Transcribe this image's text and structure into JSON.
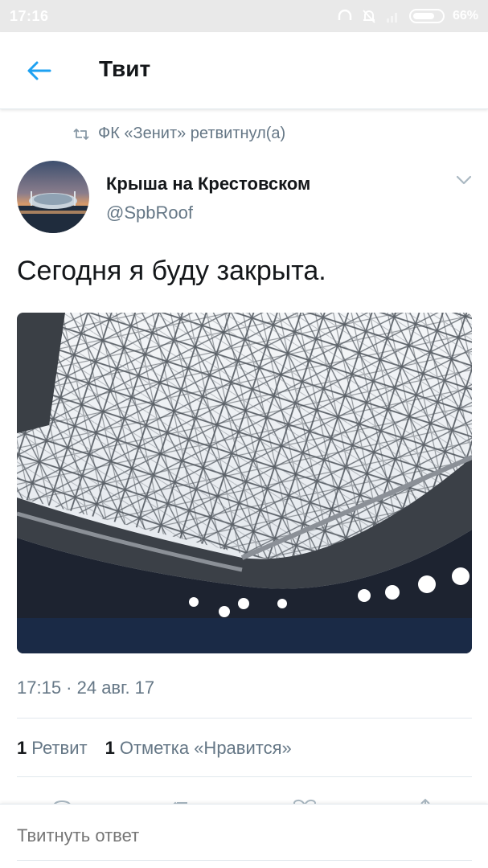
{
  "status_bar": {
    "time": "17:16",
    "battery": "66%"
  },
  "header": {
    "title": "Твит"
  },
  "tweet": {
    "retweeted_by": "ФК «Зенит» ретвитнул(а)",
    "author_name": "Крыша на Крестовском",
    "author_handle": "@SpbRoof",
    "text": "Сегодня я буду закрыта.",
    "timestamp": "17:15 · 24 авг. 17",
    "retweet_count": "1",
    "retweet_label": "Ретвит",
    "like_count": "1",
    "like_label": "Отметка «Нравится»"
  },
  "reply": {
    "placeholder": "Твитнуть ответ"
  },
  "colors": {
    "accent": "#1da1f2",
    "secondary_text": "#657786",
    "primary_text": "#14171a",
    "divider": "#e1e8ed"
  },
  "icons": {
    "back": "back-arrow-icon",
    "retweet": "retweet-icon",
    "caret": "chevron-down-icon",
    "battery": "battery-icon"
  }
}
